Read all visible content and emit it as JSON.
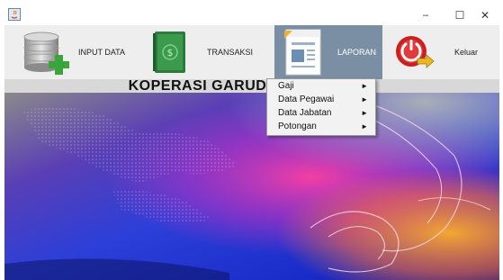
{
  "window": {
    "title": "",
    "controls": {
      "minimize": "–",
      "maximize": "☐",
      "close": "✕"
    }
  },
  "menu": {
    "items": [
      {
        "label": "INPUT DATA",
        "icon": "database-add-icon"
      },
      {
        "label": "TRANSAKSI",
        "icon": "money-book-icon"
      },
      {
        "label": "LAPORAN",
        "icon": "report-document-icon",
        "active": true
      },
      {
        "label": "Keluar",
        "icon": "power-exit-icon"
      }
    ]
  },
  "heading": {
    "title": "KOPERASI GARUDA NUSANTARA"
  },
  "dropdown": {
    "items": [
      {
        "label": "Gaji",
        "submenu_arrow": "►"
      },
      {
        "label": "Data Pegawai",
        "submenu_arrow": "►"
      },
      {
        "label": "Data Jabatan",
        "submenu_arrow": "►"
      },
      {
        "label": "Potongan",
        "submenu_arrow": "►"
      }
    ]
  },
  "colors": {
    "menubar_bg": "#eeeeee",
    "active_menu_bg": "#7a8fa3",
    "heading_bg": "#d8d8d8"
  }
}
